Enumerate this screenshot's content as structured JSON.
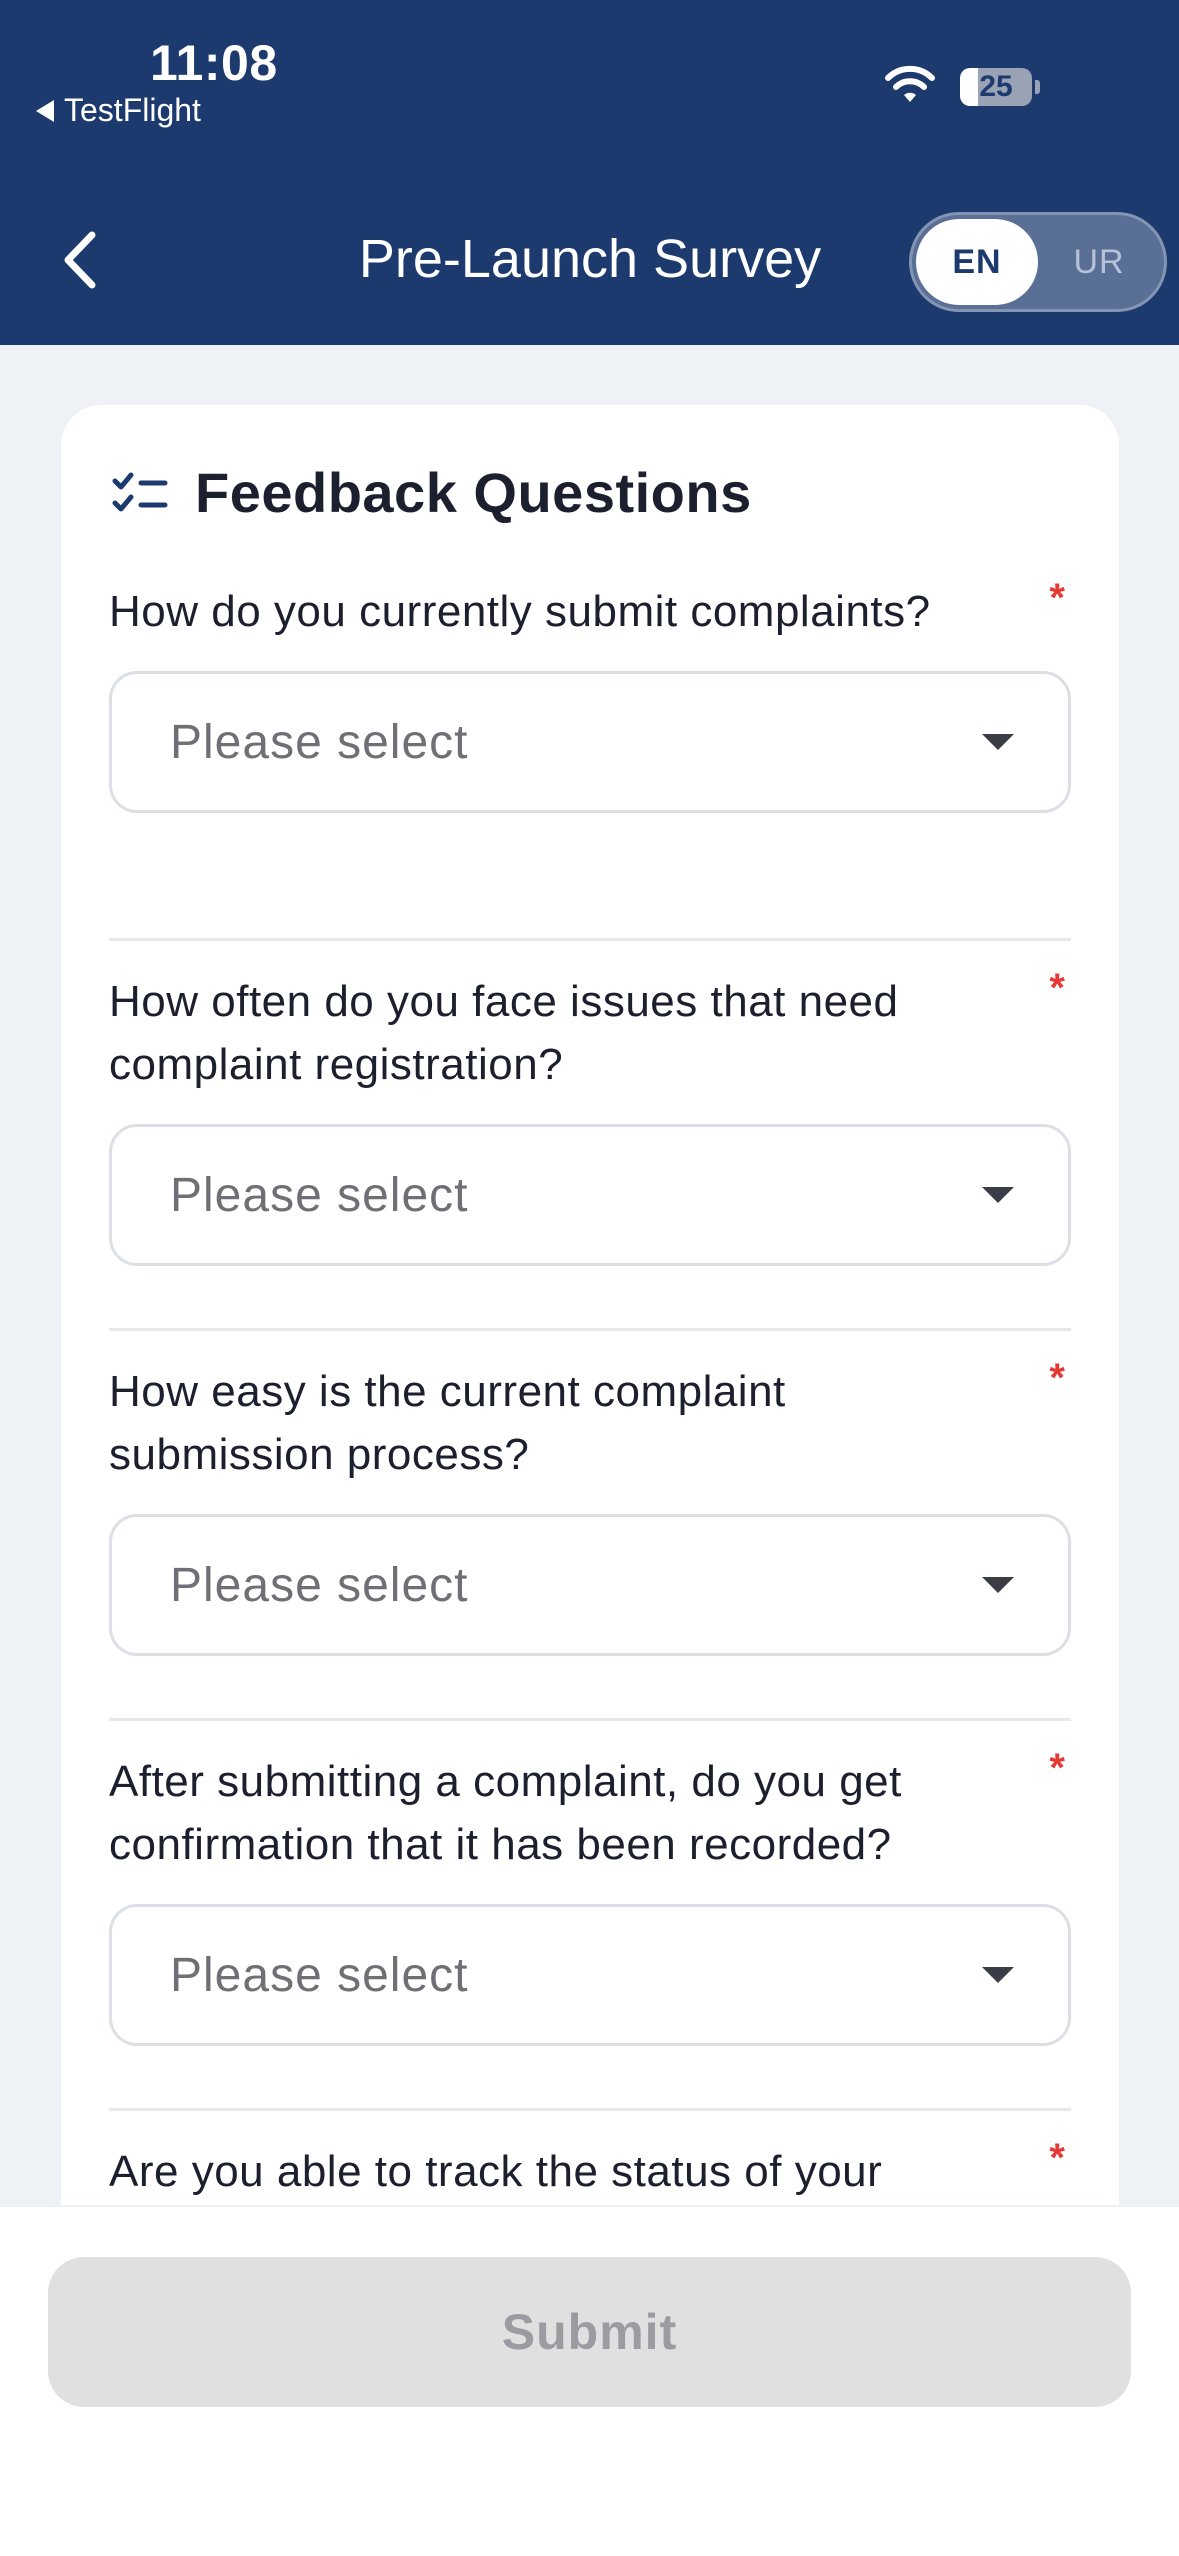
{
  "status_bar": {
    "time": "11:08",
    "back_app": "TestFlight",
    "battery": "25",
    "battery_level": 0.25
  },
  "header": {
    "title": "Pre-Launch Survey",
    "lang_en": "EN",
    "lang_ur": "UR",
    "selected_lang": "EN"
  },
  "card": {
    "title": "Feedback Questions",
    "questions": [
      {
        "label": "How do you currently submit complaints?",
        "required": "*",
        "placeholder": "Please select"
      },
      {
        "label": "How often do you face issues that need complaint registration?",
        "required": "*",
        "placeholder": "Please select"
      },
      {
        "label": "How easy is the current complaint submission process?",
        "required": "*",
        "placeholder": "Please select"
      },
      {
        "label": "After submitting a complaint, do you get confirmation that it has been recorded?",
        "required": "*",
        "placeholder": "Please select"
      },
      {
        "label": "Are you able to track the status of your",
        "required": "*"
      }
    ]
  },
  "footer": {
    "submit_label": "Submit"
  },
  "colors": {
    "header_bg": "#1c3a6e",
    "required": "#e53935",
    "submit_disabled_bg": "#e0e0e0"
  }
}
